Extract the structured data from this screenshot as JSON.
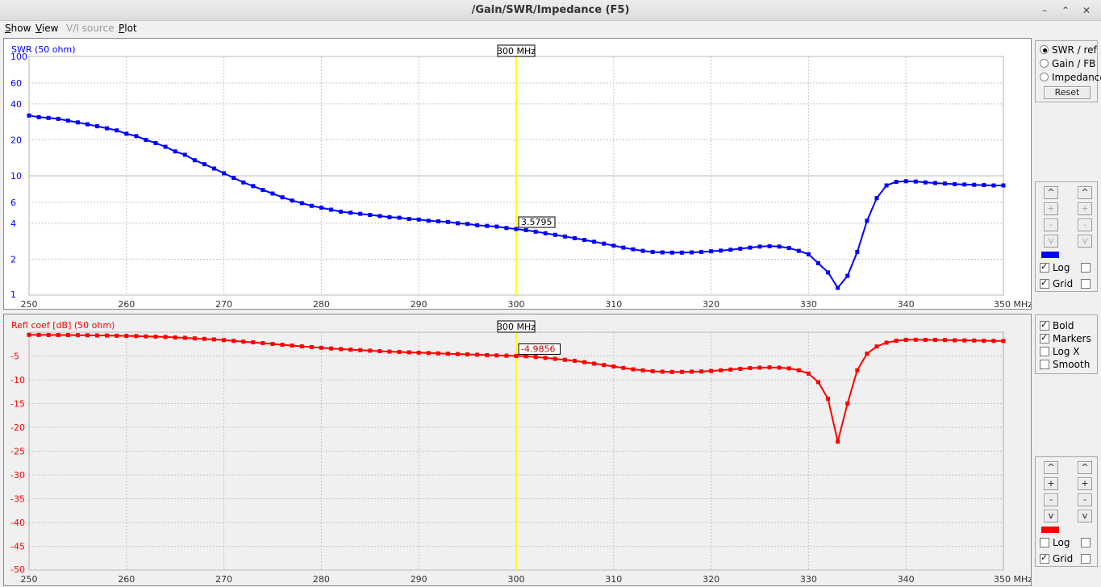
{
  "window": {
    "title": "/Gain/SWR/Impedance (F5)"
  },
  "menu": [
    {
      "label": "Show",
      "ul": "S",
      "rest": "how",
      "disabled": false
    },
    {
      "label": "View",
      "ul": "V",
      "rest": "iew",
      "disabled": false
    },
    {
      "label": "V/I source",
      "ul": "",
      "rest": "V/I source",
      "disabled": true
    },
    {
      "label": "Plot",
      "ul": "P",
      "rest": "lot",
      "disabled": false
    }
  ],
  "right_panel": {
    "mode_options": [
      "SWR / ref",
      "Gain / FB",
      "Impedance"
    ],
    "selected_mode": "SWR / ref",
    "reset_label": "Reset",
    "top_axis_controls": {
      "up": "^",
      "plus": "+",
      "minus": "-",
      "down": "v",
      "log_label": "Log",
      "grid_label": "Grid",
      "log_checked": true,
      "grid_checked": true,
      "color": "#0000ff"
    },
    "options": [
      {
        "label": "Bold",
        "checked": true
      },
      {
        "label": "Markers",
        "checked": true
      },
      {
        "label": "Log X",
        "checked": false
      },
      {
        "label": "Smooth",
        "checked": false
      }
    ],
    "bottom_axis_controls": {
      "up": "^",
      "plus": "+",
      "minus": "-",
      "down": "v",
      "log_label": "Log",
      "grid_label": "Grid",
      "log_checked": false,
      "grid_checked": true,
      "color": "#ff0000"
    }
  },
  "chart_data": [
    {
      "type": "line",
      "ylabel": "SWR (50 ohm)",
      "yscale": "log",
      "ylim": [
        1,
        100
      ],
      "yticks": [
        1,
        2,
        4,
        6,
        10,
        20,
        40,
        60,
        100
      ],
      "xlim": [
        250,
        350
      ],
      "xticks": [
        250,
        260,
        270,
        280,
        290,
        300,
        310,
        320,
        330,
        340,
        350
      ],
      "xunit": "MHz",
      "grid": true,
      "color": "#0000ff",
      "marker": {
        "x": 300,
        "label": "300 MHz",
        "value_label": "3.5795"
      },
      "series": [
        {
          "x": [
            250,
            251,
            252,
            253,
            254,
            255,
            256,
            257,
            258,
            259,
            260,
            261,
            262,
            263,
            264,
            265,
            266,
            267,
            268,
            269,
            270,
            271,
            272,
            273,
            274,
            275,
            276,
            277,
            278,
            279,
            280,
            281,
            282,
            283,
            284,
            285,
            286,
            287,
            288,
            289,
            290,
            291,
            292,
            293,
            294,
            295,
            296,
            297,
            298,
            299,
            300,
            301,
            302,
            303,
            304,
            305,
            306,
            307,
            308,
            309,
            310,
            311,
            312,
            313,
            314,
            315,
            316,
            317,
            318,
            319,
            320,
            321,
            322,
            323,
            324,
            325,
            326,
            327,
            328,
            329,
            330,
            331,
            332,
            333,
            334,
            335,
            336,
            337,
            338,
            339,
            340,
            341,
            342,
            343,
            344,
            345,
            346,
            347,
            348,
            349,
            350
          ],
          "y": [
            32,
            31,
            30.5,
            30,
            29,
            28,
            27,
            26,
            25,
            24,
            22.5,
            21.5,
            20,
            18.8,
            17.5,
            16,
            15,
            13.5,
            12.5,
            11.5,
            10.5,
            9.6,
            8.8,
            8.2,
            7.6,
            7.1,
            6.6,
            6.2,
            5.9,
            5.6,
            5.4,
            5.2,
            5.0,
            4.9,
            4.8,
            4.7,
            4.6,
            4.5,
            4.45,
            4.35,
            4.3,
            4.2,
            4.15,
            4.1,
            4.0,
            3.95,
            3.85,
            3.8,
            3.75,
            3.65,
            3.58,
            3.5,
            3.4,
            3.3,
            3.2,
            3.1,
            3.0,
            2.9,
            2.8,
            2.7,
            2.6,
            2.5,
            2.42,
            2.35,
            2.3,
            2.28,
            2.27,
            2.27,
            2.28,
            2.3,
            2.33,
            2.36,
            2.4,
            2.45,
            2.5,
            2.55,
            2.57,
            2.55,
            2.48,
            2.35,
            2.2,
            1.85,
            1.55,
            1.15,
            1.45,
            2.3,
            4.2,
            6.5,
            8.3,
            8.9,
            9.0,
            8.95,
            8.8,
            8.7,
            8.6,
            8.5,
            8.45,
            8.4,
            8.35,
            8.3,
            8.3
          ]
        }
      ]
    },
    {
      "type": "line",
      "ylabel": "Refl coef [dB] (50 ohm)",
      "ylim": [
        -50,
        0
      ],
      "yticks": [
        -50,
        -45,
        -40,
        -35,
        -30,
        -25,
        -20,
        -15,
        -10,
        -5
      ],
      "xlim": [
        250,
        350
      ],
      "xticks": [
        250,
        260,
        270,
        280,
        290,
        300,
        310,
        320,
        330,
        340,
        350
      ],
      "xunit": "MHz",
      "grid": true,
      "color": "#ff0000",
      "marker": {
        "x": 300,
        "label": "300 MHz",
        "value_label": "-4.9856"
      },
      "series": [
        {
          "x": [
            250,
            251,
            252,
            253,
            254,
            255,
            256,
            257,
            258,
            259,
            260,
            261,
            262,
            263,
            264,
            265,
            266,
            267,
            268,
            269,
            270,
            271,
            272,
            273,
            274,
            275,
            276,
            277,
            278,
            279,
            280,
            281,
            282,
            283,
            284,
            285,
            286,
            287,
            288,
            289,
            290,
            291,
            292,
            293,
            294,
            295,
            296,
            297,
            298,
            299,
            300,
            301,
            302,
            303,
            304,
            305,
            306,
            307,
            308,
            309,
            310,
            311,
            312,
            313,
            314,
            315,
            316,
            317,
            318,
            319,
            320,
            321,
            322,
            323,
            324,
            325,
            326,
            327,
            328,
            329,
            330,
            331,
            332,
            333,
            334,
            335,
            336,
            337,
            338,
            339,
            340,
            341,
            342,
            343,
            344,
            345,
            346,
            347,
            348,
            349,
            350
          ],
          "y": [
            -0.55,
            -0.57,
            -0.58,
            -0.59,
            -0.6,
            -0.62,
            -0.65,
            -0.68,
            -0.7,
            -0.74,
            -0.78,
            -0.82,
            -0.88,
            -0.94,
            -1.0,
            -1.1,
            -1.18,
            -1.3,
            -1.4,
            -1.52,
            -1.66,
            -1.82,
            -1.98,
            -2.13,
            -2.3,
            -2.46,
            -2.64,
            -2.81,
            -2.97,
            -3.12,
            -3.28,
            -3.42,
            -3.55,
            -3.66,
            -3.77,
            -3.88,
            -3.98,
            -4.08,
            -4.15,
            -4.23,
            -4.3,
            -4.38,
            -4.45,
            -4.52,
            -4.6,
            -4.66,
            -4.73,
            -4.82,
            -4.88,
            -4.94,
            -4.99,
            -5.05,
            -5.2,
            -5.4,
            -5.6,
            -5.8,
            -6.0,
            -6.3,
            -6.6,
            -6.9,
            -7.2,
            -7.5,
            -7.8,
            -8.0,
            -8.2,
            -8.3,
            -8.35,
            -8.35,
            -8.3,
            -8.25,
            -8.15,
            -8.0,
            -7.85,
            -7.7,
            -7.55,
            -7.45,
            -7.4,
            -7.45,
            -7.6,
            -8.0,
            -8.7,
            -10.5,
            -14.0,
            -23.0,
            -15.0,
            -8.0,
            -4.5,
            -3.0,
            -2.2,
            -1.8,
            -1.6,
            -1.58,
            -1.6,
            -1.62,
            -1.65,
            -1.7,
            -1.72,
            -1.75,
            -1.8,
            -1.82,
            -1.85
          ]
        }
      ]
    }
  ]
}
